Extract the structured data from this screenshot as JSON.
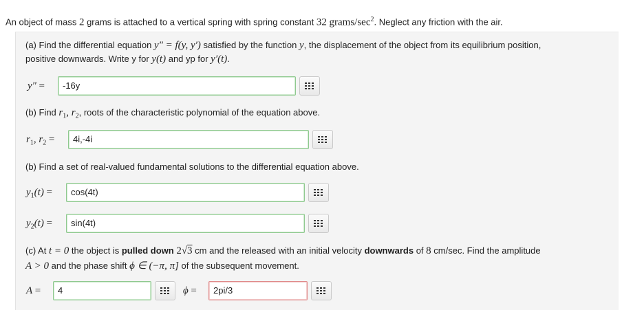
{
  "intro": {
    "pre": "An object of mass ",
    "mass": "2",
    "mid": " grams is attached to a vertical spring with spring constant ",
    "k": "32",
    "unit": "grams/sec",
    "unit_exp": "2",
    "post": ". Neglect any friction with the air."
  },
  "part_a": {
    "t1": "(a) Find the differential equation ",
    "eq": "y″ = f(y, y′)",
    "t2": " satisfied by the function ",
    "var": "y",
    "t3": ", the displacement of the object from its equilibrium position,",
    "line2_t1": "positive downwards. Write y for ",
    "yt": "y(t)",
    "line2_t2": " and yp for ",
    "ypt": "y′(t)",
    "line2_t3": ".",
    "label": "y″",
    "value": "-16y"
  },
  "part_b1": {
    "t1": "(b) Find ",
    "r1": "r",
    "r1sub": "1",
    "r2": "r",
    "r2sub": "2",
    "t2": ", roots of the characteristic polynomial of the equation above.",
    "value": "4i,-4i"
  },
  "part_b2": {
    "text": "(b) Find a set of real-valued fundamental solutions to the differential equation above.",
    "y1_value": "cos(4t)",
    "y2_value": "sin(4t)"
  },
  "part_c": {
    "t1": "(c) At ",
    "t_eq": "t = 0",
    "t2": " the object is ",
    "bold1": "pulled down",
    "disp_coef": "2",
    "disp_rad": "3",
    "t3": " cm and the released with an initial velocity ",
    "bold2": "downwards",
    "t4": " of ",
    "vel": "8",
    "t5": " cm/sec. Find the amplitude",
    "line2_amp": "A > 0",
    "line2_t1": " and the phase shift ",
    "line2_phi": "ϕ ∈ (−π, π]",
    "line2_t2": " of the subsequent movement.",
    "A_label": "A",
    "A_value": "4",
    "phi_label": "ϕ",
    "phi_value": "2pi/3"
  },
  "colors": {
    "correct_border": "#8fc98f",
    "incorrect_border": "#e08a8a",
    "panel_bg": "#f4f4f4"
  },
  "icons": [
    "grid-icon"
  ]
}
